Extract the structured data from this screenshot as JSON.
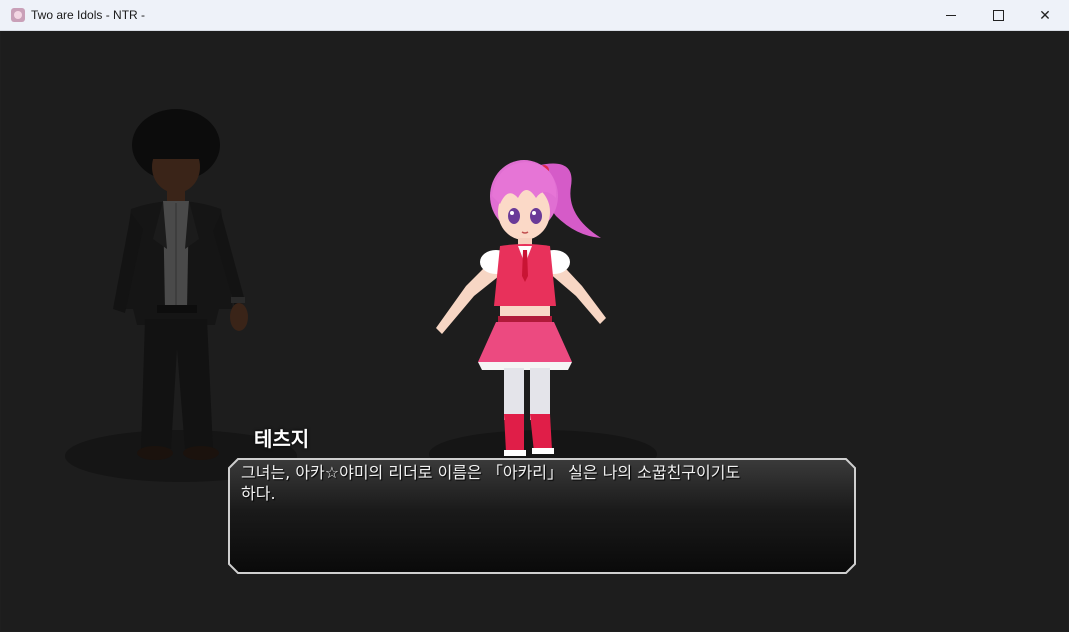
{
  "window": {
    "title": "Two are Idols - NTR -",
    "minimize_icon": "minimize-icon",
    "maximize_icon": "maximize-icon",
    "close_glyph": "✕"
  },
  "scene": {
    "characters": [
      {
        "role": "npc",
        "description_icon": "man-in-suit-sprite"
      },
      {
        "role": "idol",
        "description_icon": "pink-hair-idol-sprite"
      }
    ]
  },
  "dialogue": {
    "speaker": "테츠지",
    "text": "그녀는, 아카☆야미의 리더로 이름은 「아카리」 실은 나의 소꿉친구이기도\n하다."
  },
  "colors": {
    "background": "#1d1d1d",
    "titlebar": "#eef2f9",
    "hair": "#e56fd0",
    "outfit": "#e8315b"
  }
}
